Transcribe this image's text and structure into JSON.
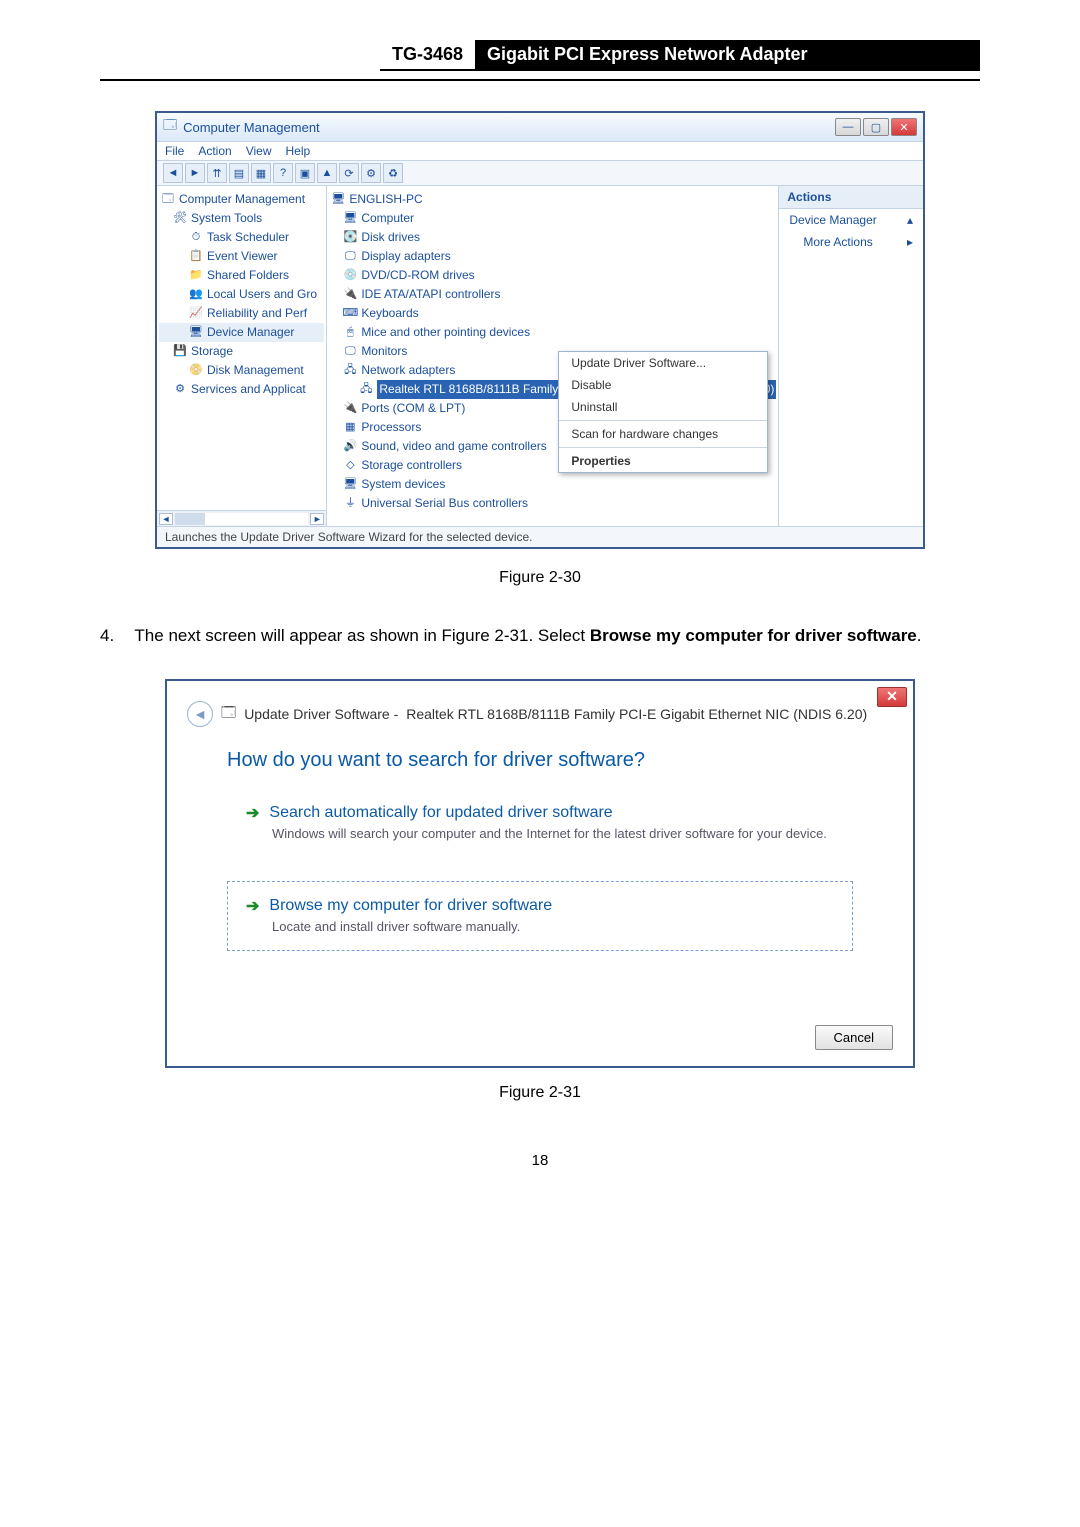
{
  "page": {
    "model": "TG-3468",
    "title": "Gigabit PCI Express Network Adapter",
    "number": "18"
  },
  "cm": {
    "title": "Computer Management",
    "menus": [
      "File",
      "Action",
      "View",
      "Help"
    ],
    "status": "Launches the Update Driver Software Wizard for the selected device.",
    "left": {
      "root": "Computer Management",
      "systools": "System Tools",
      "task": "Task Scheduler",
      "event": "Event Viewer",
      "shared": "Shared Folders",
      "localusr": "Local Users and Gro",
      "reliability": "Reliability and Perf",
      "devmgr": "Device Manager",
      "storage": "Storage",
      "diskmgmt": "Disk Management",
      "services": "Services and Applicat"
    },
    "mid": {
      "pc": "ENGLISH-PC",
      "computer": "Computer",
      "disk": "Disk drives",
      "display": "Display adapters",
      "dvd": "DVD/CD-ROM drives",
      "ide": "IDE ATA/ATAPI controllers",
      "keyboards": "Keyboards",
      "mice": "Mice and other pointing devices",
      "monitors": "Monitors",
      "network": "Network adapters",
      "realtek": "Realtek RTL 8168B/8111B Family PCI-E Gigabit Ethernet NIC (NDIS 6.20)",
      "ports": "Ports (COM & LPT)",
      "processors": "Processors",
      "sound": "Sound, video and game controllers",
      "storagectl": "Storage controllers",
      "sysdev": "System devices",
      "usb": "Universal Serial Bus controllers"
    },
    "actions": {
      "header": "Actions",
      "devmgr": "Device Manager",
      "more": "More Actions"
    },
    "ctx": {
      "update": "Update Driver Software...",
      "disable": "Disable",
      "uninstall": "Uninstall",
      "scan": "Scan for hardware changes",
      "props": "Properties"
    }
  },
  "fig1": "Figure 2-30",
  "para": {
    "num": "4.",
    "text_a": "The next screen will appear as shown in Figure 2-31. Select ",
    "bold": "Browse my computer for driver software",
    "text_b": "."
  },
  "wiz": {
    "header_prefix": "Update Driver Software -",
    "header_device": "Realtek RTL 8168B/8111B Family PCI-E Gigabit Ethernet NIC (NDIS 6.20)",
    "question": "How do you want to search for driver software?",
    "opt1_title": "Search automatically for updated driver software",
    "opt1_desc": "Windows will search your computer and the Internet for the latest driver software for your device.",
    "opt2_title": "Browse my computer for driver software",
    "opt2_desc": "Locate and install driver software manually.",
    "cancel": "Cancel"
  },
  "fig2": "Figure 2-31"
}
